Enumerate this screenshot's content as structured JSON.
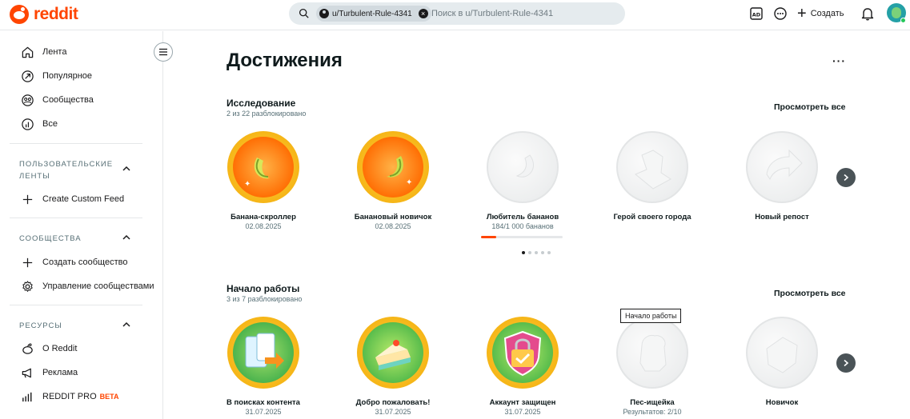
{
  "header": {
    "logo_text": "reddit",
    "search_chip": "u/Turbulent-Rule-4341",
    "search_placeholder": "Поиск в u/Turbulent-Rule-4341",
    "create_label": "Создать"
  },
  "sidebar": {
    "main_items": [
      {
        "label": "Лента",
        "icon": "home-icon"
      },
      {
        "label": "Популярное",
        "icon": "popular-icon"
      },
      {
        "label": "Сообщества",
        "icon": "communities-icon"
      },
      {
        "label": "Все",
        "icon": "all-icon"
      }
    ],
    "custom_feeds": {
      "title": "ПОЛЬЗОВАТЕЛЬСКИЕ ЛЕНТЫ",
      "items": [
        {
          "label": "Create Custom Feed",
          "icon": "plus-icon"
        }
      ]
    },
    "communities": {
      "title": "СООБЩЕСТВА",
      "items": [
        {
          "label": "Создать сообщество",
          "icon": "plus-icon"
        },
        {
          "label": "Управление сообществами",
          "icon": "gear-icon"
        }
      ]
    },
    "resources": {
      "title": "РЕСУРСЫ",
      "items": [
        {
          "label": "О Reddit",
          "icon": "reddit-icon"
        },
        {
          "label": "Реклама",
          "icon": "megaphone-icon"
        },
        {
          "label": "REDDIT PRO",
          "icon": "bar-chart-icon",
          "badge": "BETA"
        }
      ]
    }
  },
  "main": {
    "title": "Достижения",
    "more_label": "···",
    "sections": [
      {
        "title": "Исследование",
        "subtitle": "2 из 22 разблокировано",
        "view_all": "Просмотреть все",
        "achievements": [
          {
            "name": "Банана-скроллер",
            "meta": "02.08.2025",
            "unlocked": true
          },
          {
            "name": "Банановый новичок",
            "meta": "02.08.2025",
            "unlocked": true
          },
          {
            "name": "Любитель бананов",
            "meta": "184/1 000 бананов",
            "unlocked": false,
            "progress": 0.184
          },
          {
            "name": "Герой своего города",
            "meta": "",
            "unlocked": false
          },
          {
            "name": "Новый репост",
            "meta": "",
            "unlocked": false
          }
        ],
        "pagination_count": 5,
        "pagination_active": 0
      },
      {
        "title": "Начало работы",
        "subtitle": "3 из 7 разблокировано",
        "view_all": "Просмотреть все",
        "tooltip": "Начало работы",
        "achievements": [
          {
            "name": "В поисках контента",
            "meta": "31.07.2025",
            "unlocked": true
          },
          {
            "name": "Добро пожаловать!",
            "meta": "31.07.2025",
            "unlocked": true
          },
          {
            "name": "Аккаунт защищен",
            "meta": "31.07.2025",
            "unlocked": true
          },
          {
            "name": "Пес-ищейка",
            "meta": "Результатов: 2/10",
            "unlocked": false
          },
          {
            "name": "Новичок",
            "meta": "",
            "unlocked": false
          }
        ]
      }
    ]
  },
  "colors": {
    "brand": "#ff4500",
    "gold": "#f2a900",
    "locked": "#e7e9ea"
  }
}
